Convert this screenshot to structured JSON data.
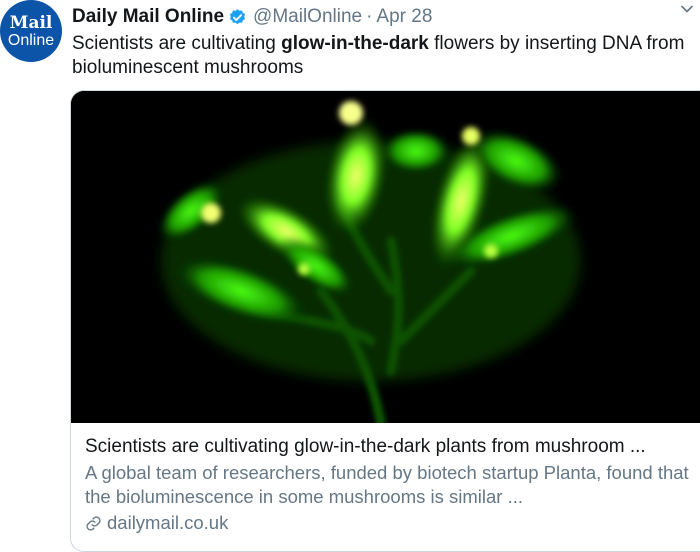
{
  "avatar": {
    "line1": "Mail",
    "line2": "Online"
  },
  "tweet": {
    "author_name": "Daily Mail Online",
    "handle": "@MailOnline",
    "separator": "·",
    "date": "Apr 28",
    "text_before": "Scientists are cultivating ",
    "text_bold": "glow-in-the-dark",
    "text_after": " flowers by inserting DNA from bioluminescent mushrooms"
  },
  "card": {
    "image_subject": "glowing-green-flowers-photo",
    "title": "Scientists are cultivating glow-in-the-dark plants from mushroom ...",
    "description": "A global team of researchers, funded by biotech startup Planta, found that the bioluminescence in some mushrooms is similar ...",
    "domain": "dailymail.co.uk"
  },
  "icons": {
    "verified": "verified-badge-icon",
    "menu": "chevron-down-icon",
    "link": "link-icon"
  },
  "colors": {
    "brand_blue": "#0b54a8",
    "verified_blue": "#1da1f2",
    "secondary_text": "#657786",
    "glow_green": "#39ff14"
  }
}
